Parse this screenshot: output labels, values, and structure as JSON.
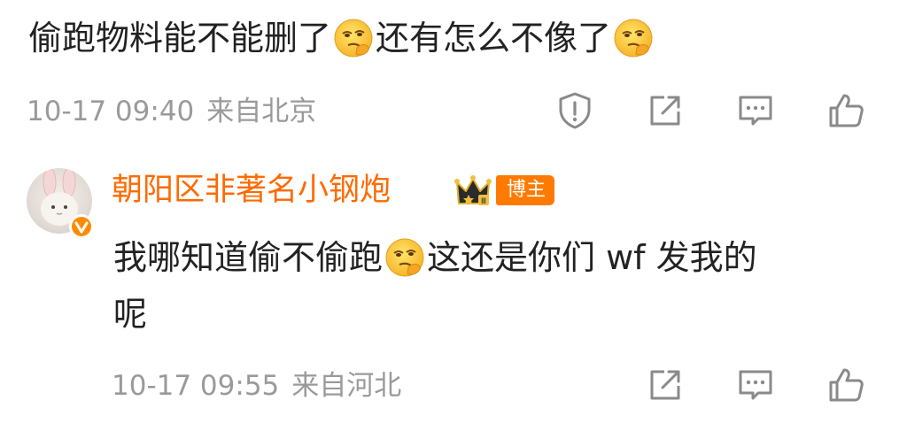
{
  "comment": {
    "text_part1": "偷跑物料能不能删了",
    "text_part2": "还有怎么不像了",
    "time": "10-17 09:40",
    "location": "来自北京",
    "emoji": "thinking-face-emoji"
  },
  "reply": {
    "username": "朝阳区非著名小钢炮",
    "badge_tag": "博主",
    "text_part1": "我哪知道偷不偷跑",
    "text_part2": "这还是你们 wf 发我的",
    "text_part3": "呢",
    "time": "10-17 09:55",
    "location": "来自河北",
    "emoji": "thinking-face-emoji"
  },
  "actions": {
    "report": "report-icon",
    "share": "share-icon",
    "comment": "comment-icon",
    "like": "like-icon"
  },
  "colors": {
    "text": "#222222",
    "meta": "#9a9a9a",
    "icon": "#8a8a8a",
    "username": "#ff6a00",
    "tag": "#ff7a00"
  }
}
